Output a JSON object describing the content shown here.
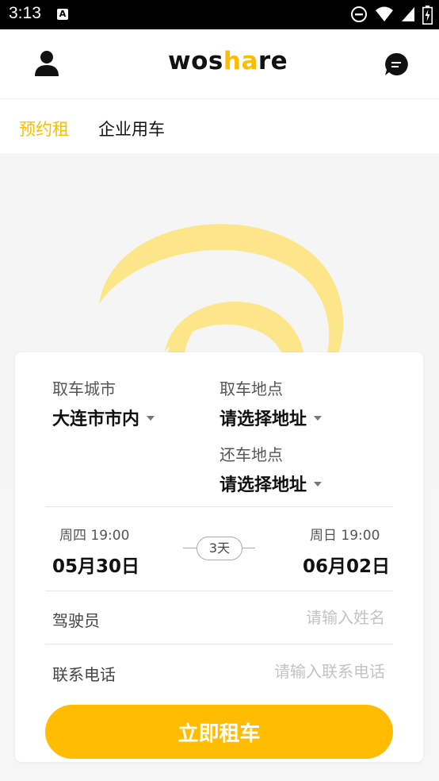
{
  "status_bar": {
    "time": "3:13",
    "notification_icon": "A",
    "icons": [
      "do-not-disturb-icon",
      "wifi-icon",
      "signal-icon",
      "battery-charging-icon"
    ]
  },
  "app_bar": {
    "logo_prefix": "wos",
    "logo_highlight": "ha",
    "logo_suffix": "re",
    "brand_color": "#ffbc00"
  },
  "tabs": [
    {
      "label": "预约租",
      "active": true
    },
    {
      "label": "企业用车",
      "active": false
    }
  ],
  "form": {
    "pickup_city_label": "取车城市",
    "pickup_city_value": "大连市市内",
    "pickup_location_label": "取车地点",
    "pickup_location_value": "请选择地址",
    "return_location_label": "还车地点",
    "return_location_value": "请选择地址",
    "start": {
      "weekday_time": "周四 19:00",
      "date": "05月30日"
    },
    "duration": "3天",
    "end": {
      "weekday_time": "周日 19:00",
      "date": "06月02日"
    },
    "driver_label": "驾驶员",
    "driver_placeholder": "请输入姓名",
    "phone_label": "联系电话",
    "phone_placeholder": "请输入联系电话",
    "submit_label": "立即租车"
  }
}
